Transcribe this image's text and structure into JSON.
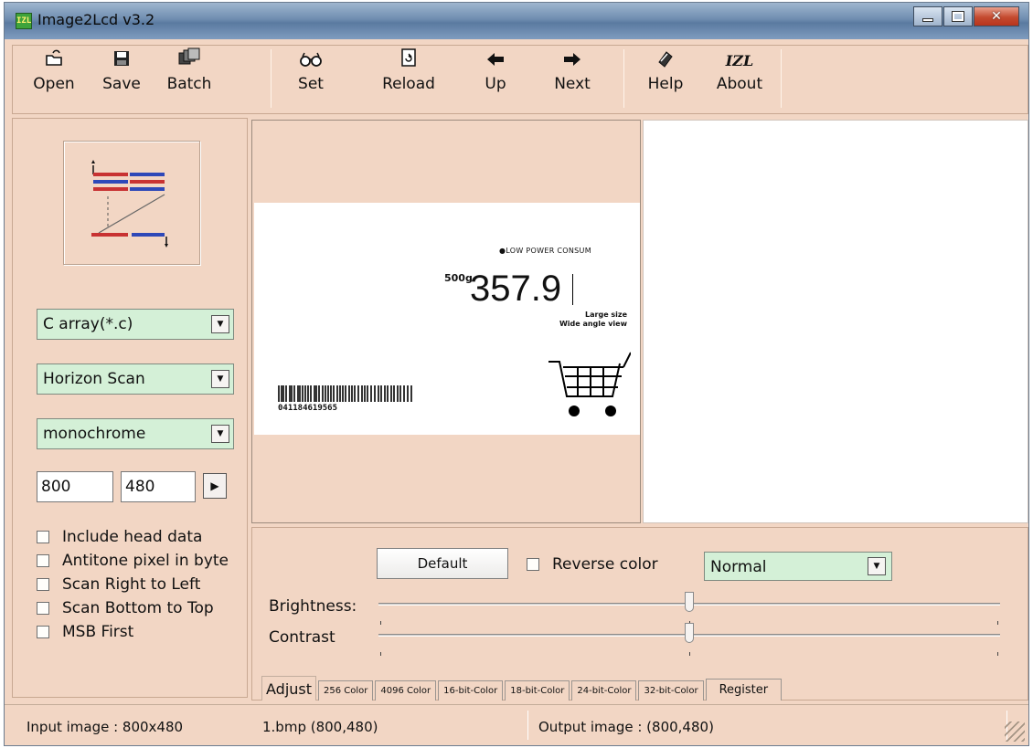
{
  "window": {
    "title": "Image2Lcd v3.2",
    "icon_text": "IZL"
  },
  "toolbar": {
    "open": "Open",
    "save": "Save",
    "batch": "Batch",
    "set": "Set",
    "reload": "Reload",
    "up": "Up",
    "next": "Next",
    "help": "Help",
    "about": "About",
    "about_icon_text": "IZL"
  },
  "left_panel": {
    "output_format": "C array(*.c)",
    "scan_mode": "Horizon Scan",
    "gray_mode": "monochrome",
    "width": "800",
    "height": "480",
    "options": [
      {
        "label": "Include head data",
        "checked": false
      },
      {
        "label": "Antitone pixel in byte",
        "checked": false
      },
      {
        "label": "Scan Right to Left",
        "checked": false
      },
      {
        "label": "Scan Bottom to Top",
        "checked": false
      },
      {
        "label": "MSB First",
        "checked": false
      }
    ]
  },
  "preview": {
    "low_power": "●LOW POWER CONSUM",
    "weight_unit": "500g",
    "weight_value": "357.9",
    "size_line1": "Large size",
    "size_line2": "Wide angle view",
    "barcode_number": "041184619565"
  },
  "adjust": {
    "default_label": "Default",
    "reverse_color_label": "Reverse color",
    "reverse_color_checked": false,
    "mode_value": "Normal",
    "brightness_label": "Brightness:",
    "brightness_level": 0.5,
    "contrast_label": "Contrast",
    "contrast_level": 0.5
  },
  "tabs": [
    {
      "label": "Adjust",
      "active": true
    },
    {
      "label": "256 Color"
    },
    {
      "label": "4096 Color"
    },
    {
      "label": "16-bit-Color"
    },
    {
      "label": "18-bit-Color"
    },
    {
      "label": "24-bit-Color"
    },
    {
      "label": "32-bit-Color"
    },
    {
      "label": "Register"
    }
  ],
  "status": {
    "input_image": "Input image : 800x480",
    "file": "1.bmp (800,480)",
    "output_image": "Output image : (800,480)"
  }
}
